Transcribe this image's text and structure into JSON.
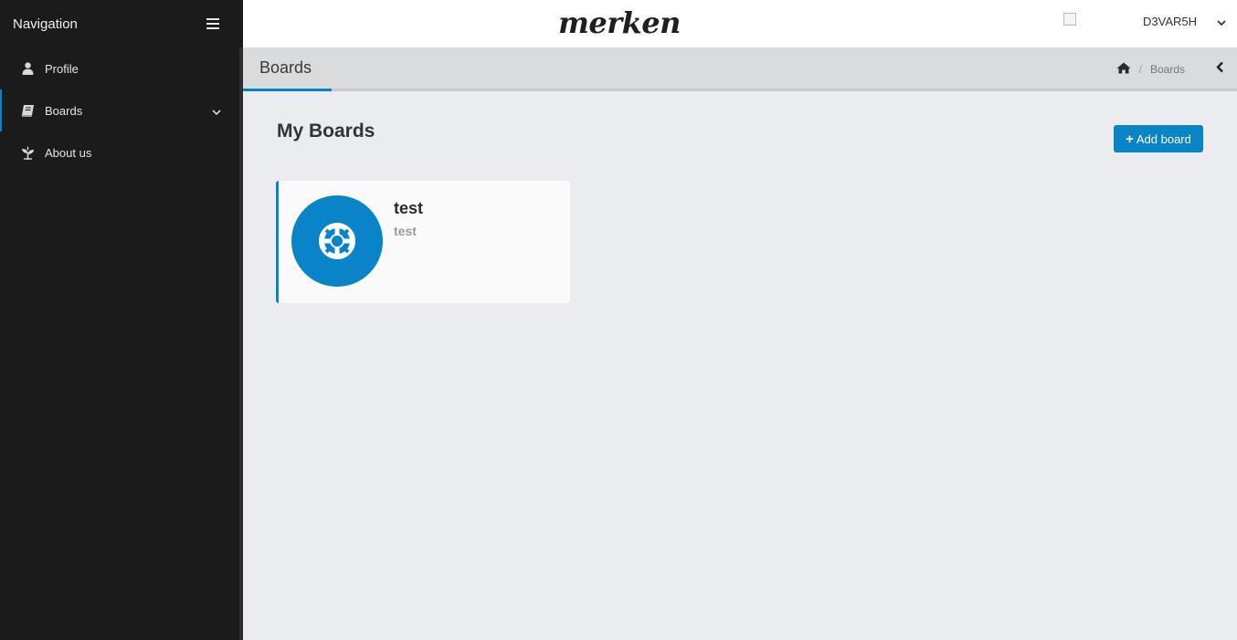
{
  "sidebar": {
    "title": "Navigation",
    "items": [
      {
        "label": "Profile",
        "icon": "user-icon"
      },
      {
        "label": "Boards",
        "icon": "book-icon"
      },
      {
        "label": "About us",
        "icon": "leaf-icon"
      }
    ]
  },
  "header": {
    "logo": "merken",
    "username": "D3VAR5H"
  },
  "page": {
    "title": "Boards",
    "breadcrumb": {
      "separator": "/",
      "current": "Boards"
    }
  },
  "main": {
    "section_title": "My Boards",
    "add_button_label": "Add board",
    "boards": [
      {
        "name": "test",
        "description": "test",
        "icon": "life-ring-icon"
      }
    ]
  },
  "colors": {
    "accent": "#0a84c8",
    "sidebar_bg": "#1b1b1b",
    "content_bg": "#eaecf0"
  }
}
